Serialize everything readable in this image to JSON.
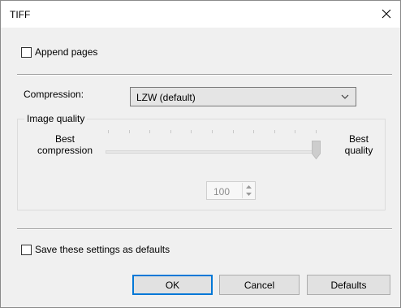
{
  "window": {
    "title": "TIFF"
  },
  "append_pages": {
    "label": "Append pages",
    "checked": false
  },
  "compression": {
    "label": "Compression:",
    "selected": "LZW (default)"
  },
  "image_quality": {
    "group_label": "Image quality",
    "left_label_line1": "Best",
    "left_label_line2": "compression",
    "right_label_line1": "Best",
    "right_label_line2": "quality",
    "slider_value": 1.0,
    "spin_value": "100"
  },
  "save_defaults": {
    "label": "Save these settings as defaults",
    "checked": false
  },
  "buttons": {
    "ok": "OK",
    "cancel": "Cancel",
    "defaults": "Defaults"
  },
  "icons": {
    "close": "close-icon",
    "dropdown": "chevron-down-icon",
    "spin_up": "spin-up-icon",
    "spin_down": "spin-down-icon"
  },
  "colors": {
    "ok_border": "#0078d7"
  }
}
